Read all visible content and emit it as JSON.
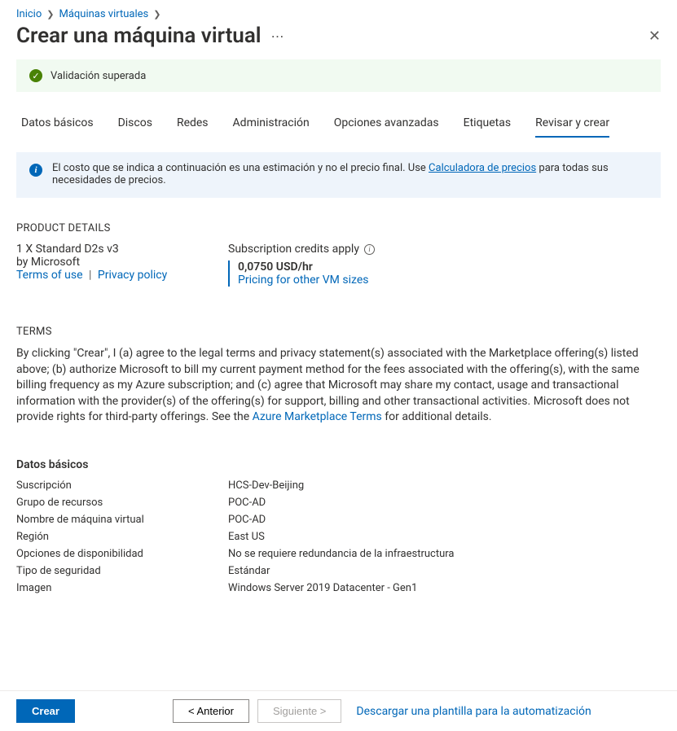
{
  "breadcrumb": {
    "items": [
      "Inicio",
      "Máquinas virtuales"
    ]
  },
  "title": "Crear una máquina virtual",
  "validation": {
    "text": "Validación superada"
  },
  "tabs": [
    "Datos básicos",
    "Discos",
    "Redes",
    "Administración",
    "Opciones avanzadas",
    "Etiquetas",
    "Revisar y crear"
  ],
  "active_tab_index": 6,
  "infobox": {
    "text_before": "El costo que se indica a continuación es una estimación y no el precio final. Use ",
    "link": "Calculadora de precios",
    "text_after": " para todas sus necesidades de precios."
  },
  "product_details": {
    "heading": "PRODUCT DETAILS",
    "sku": "1 X Standard D2s v3",
    "by_label": "by Microsoft",
    "terms_link": "Terms of use",
    "privacy_link": "Privacy policy",
    "credits_label": "Subscription credits apply",
    "price": "0,0750 USD/hr",
    "pricing_link": "Pricing for other VM sizes"
  },
  "terms": {
    "heading": "TERMS",
    "body_before": "By clicking \"Crear\", I (a) agree to the legal terms and privacy statement(s) associated with the Marketplace offering(s) listed above; (b) authorize Microsoft to bill my current payment method for the fees associated with the offering(s), with the same billing frequency as my Azure subscription; and (c) agree that Microsoft may share my contact, usage and transactional information with the provider(s) of the offering(s) for support, billing and other transactional activities. Microsoft does not provide rights for third-party offerings. See the ",
    "link": "Azure Marketplace Terms",
    "body_after": " for additional details."
  },
  "basics": {
    "heading": "Datos básicos",
    "rows": [
      {
        "k": "Suscripción",
        "v": "HCS-Dev-Beijing"
      },
      {
        "k": "Grupo de recursos",
        "v": "POC-AD"
      },
      {
        "k": "Nombre de máquina virtual",
        "v": "POC-AD"
      },
      {
        "k": "Región",
        "v": "East US"
      },
      {
        "k": "Opciones de disponibilidad",
        "v": "No se requiere redundancia de la infraestructura"
      },
      {
        "k": "Tipo de seguridad",
        "v": "Estándar"
      },
      {
        "k": "Imagen",
        "v": "Windows Server 2019 Datacenter - Gen1"
      }
    ]
  },
  "footer": {
    "create": "Crear",
    "prev": "< Anterior",
    "next": "Siguiente >",
    "template_link": "Descargar una plantilla para la automatización"
  }
}
